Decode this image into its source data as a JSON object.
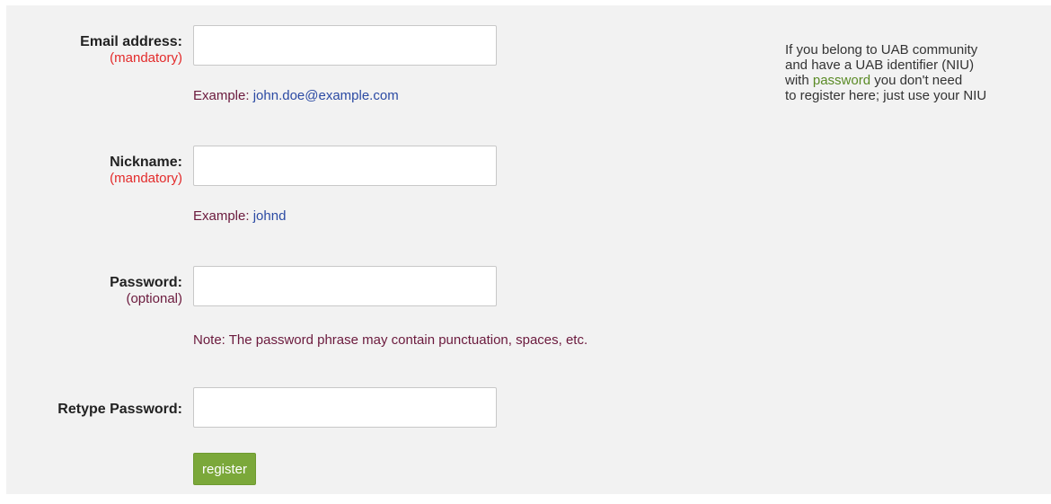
{
  "form": {
    "email": {
      "label": "Email address:",
      "requirement": "(mandatory)",
      "value": "",
      "hint_prefix": "Example:",
      "hint_value": "john.doe@example.com"
    },
    "nickname": {
      "label": "Nickname:",
      "requirement": "(mandatory)",
      "value": "",
      "hint_prefix": "Example:",
      "hint_value": "johnd"
    },
    "password": {
      "label": "Password:",
      "requirement": "(optional)",
      "value": "",
      "note": "Note: The password phrase may contain punctuation, spaces, etc."
    },
    "retype_password": {
      "label": "Retype Password:",
      "value": ""
    },
    "register_label": "register"
  },
  "info": {
    "line1": "If you belong to UAB community",
    "line2": "and have a UAB identifier (NIU)",
    "line3_prefix": "with",
    "line3_link": "password",
    "line3_suffix": "you don't need",
    "line4": "to register here; just use your NIU"
  },
  "colors": {
    "panel_background": "#f2f2f2",
    "mandatory": "#e32b2b",
    "optional": "#6b1a3d",
    "example_value": "#2b4aa3",
    "register_button": "#7ba83a",
    "info_link": "#5a8a25"
  }
}
